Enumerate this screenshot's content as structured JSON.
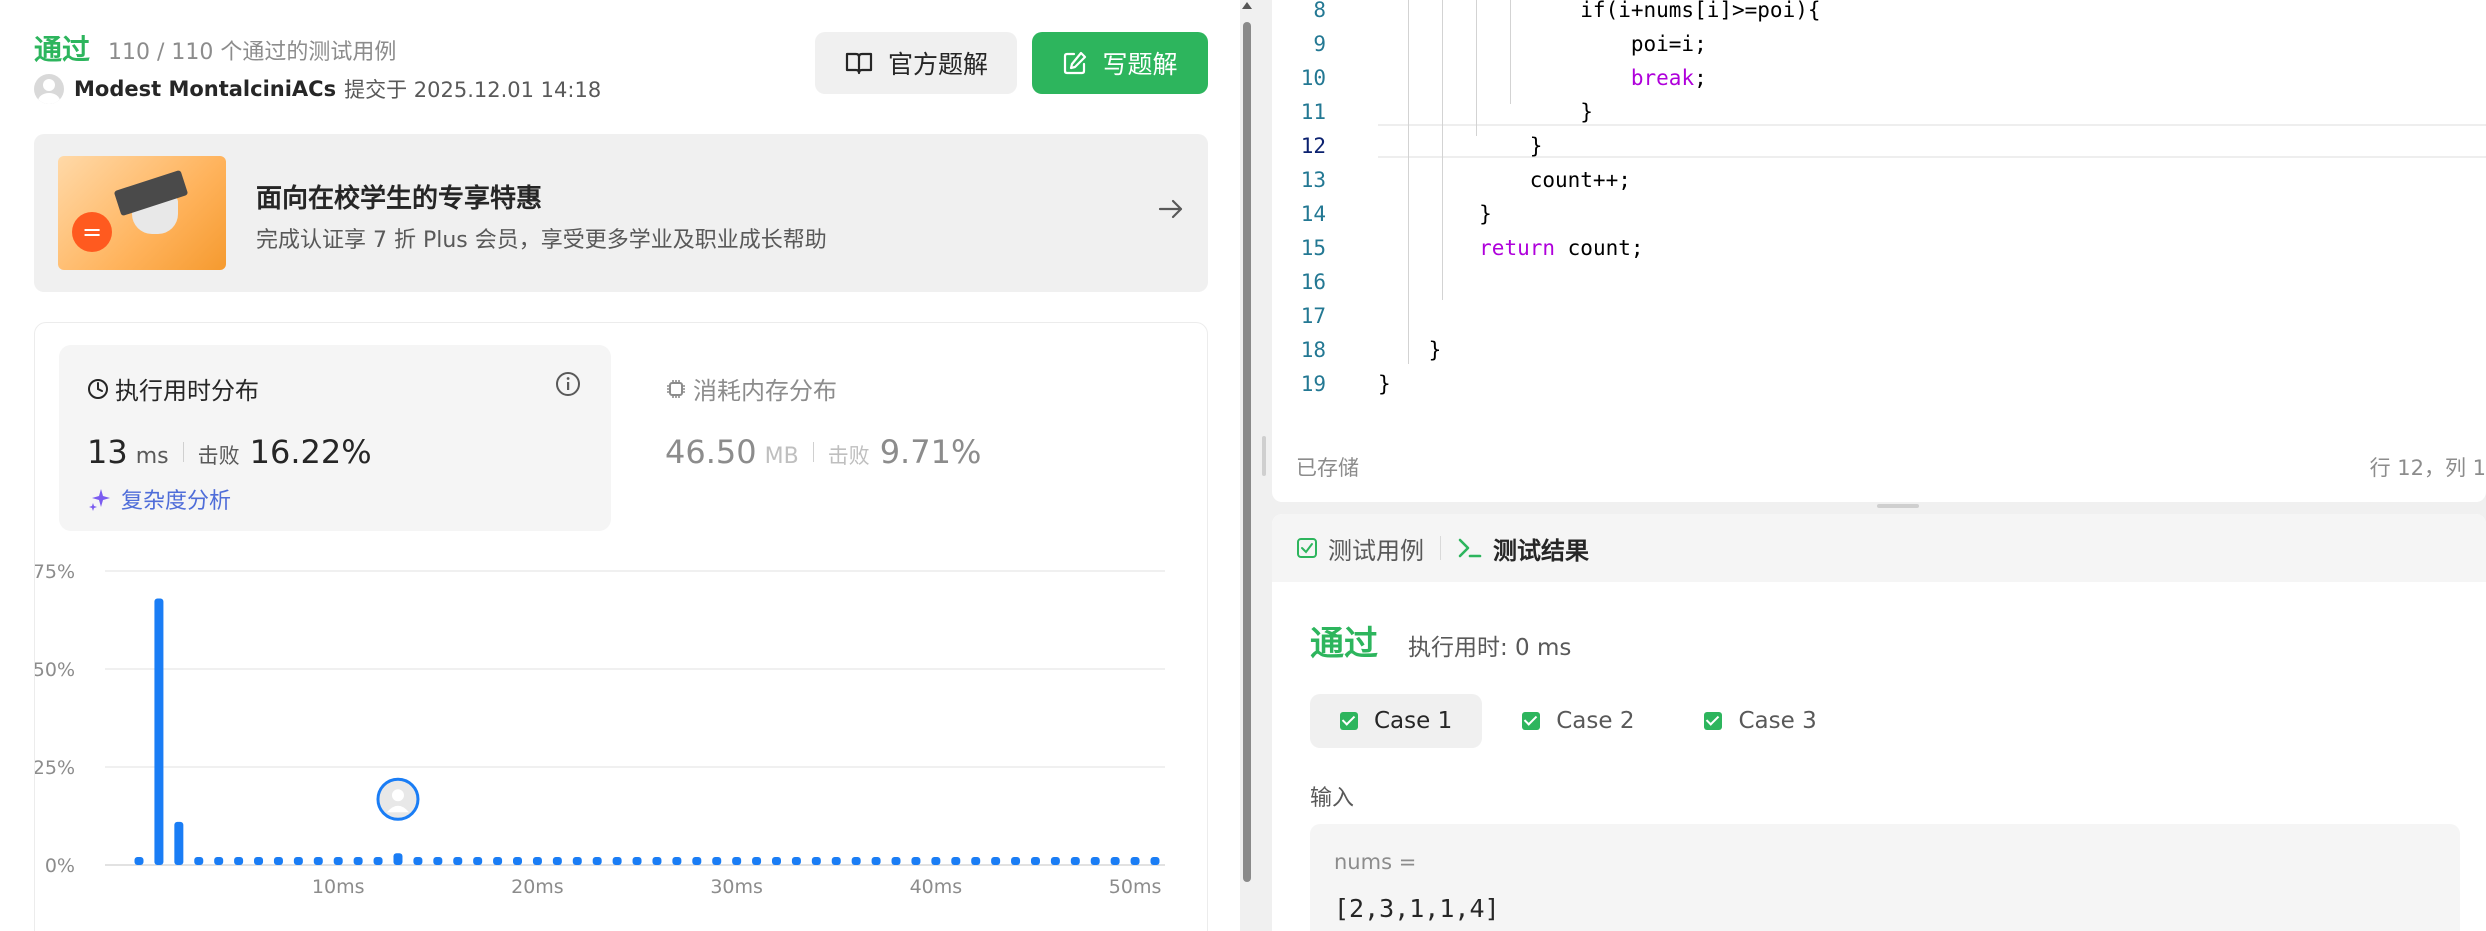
{
  "submission": {
    "status": "通过",
    "cases_summary": "110 / 110 个通过的测试用例",
    "user": "Modest MontalciniACs",
    "submitted_at": "提交于 2025.12.01 14:18"
  },
  "buttons": {
    "official_solution": "官方题解",
    "write_solution": "写题解"
  },
  "promo": {
    "badge": "=",
    "title": "面向在校学生的专享特惠",
    "subtitle": "完成认证享 7 折 Plus 会员，享受更多学业及职业成长帮助"
  },
  "runtime": {
    "title": "执行用时分布",
    "value": "13",
    "unit": "ms",
    "beat_label": "击败",
    "beat_pct": "16.22%",
    "complexity_link": "复杂度分析"
  },
  "memory": {
    "title": "消耗内存分布",
    "value": "46.50",
    "unit": "MB",
    "beat_label": "击败",
    "beat_pct": "9.71%"
  },
  "chart_data": {
    "type": "bar",
    "y_ticks": [
      "75%",
      "50%",
      "25%",
      "0%"
    ],
    "ylim": [
      0,
      75
    ],
    "x_ticks": [
      {
        "label": "10ms",
        "value": 10
      },
      {
        "label": "20ms",
        "value": 20
      },
      {
        "label": "30ms",
        "value": 30
      },
      {
        "label": "40ms",
        "value": 40
      },
      {
        "label": "50ms",
        "value": 50
      }
    ],
    "x": [
      0,
      1,
      2,
      3,
      4,
      5,
      6,
      7,
      8,
      9,
      10,
      11,
      12,
      13,
      14,
      15,
      16,
      17,
      18,
      19,
      20,
      21,
      22,
      23,
      24,
      25,
      26,
      27,
      28,
      29,
      30,
      31,
      32,
      33,
      34,
      35,
      36,
      37,
      38,
      39,
      40,
      41,
      42,
      43,
      44,
      45,
      46,
      47,
      48,
      49,
      50,
      51
    ],
    "values": [
      1.5,
      68,
      11,
      1.5,
      1.5,
      1.5,
      1.5,
      1.5,
      1.5,
      1.5,
      1.5,
      1.5,
      1.5,
      3,
      1.5,
      1.5,
      1.5,
      1.5,
      1.5,
      1.5,
      1.5,
      1.5,
      1.5,
      1.5,
      1.5,
      1.5,
      1.5,
      1.5,
      1.5,
      1.5,
      1.5,
      1.5,
      1.5,
      1.5,
      1.5,
      1.5,
      1.5,
      1.5,
      1.5,
      1.5,
      1.5,
      1.5,
      1.5,
      1.5,
      1.5,
      1.5,
      1.5,
      1.5,
      1.5,
      1.5,
      1.5,
      1.5
    ],
    "highlight_x": 13,
    "bar_color": "#1a7df5",
    "grid": true
  },
  "editor": {
    "lines": [
      {
        "n": "8",
        "text": "                if(i+nums[i]>=poi){"
      },
      {
        "n": "9",
        "text": "                    poi=i;"
      },
      {
        "n": "10",
        "text": "                    break;",
        "kw": true
      },
      {
        "n": "11",
        "text": "                }"
      },
      {
        "n": "12",
        "text": "            }"
      },
      {
        "n": "13",
        "text": "            count++;"
      },
      {
        "n": "14",
        "text": "        }"
      },
      {
        "n": "15",
        "text": "        return count;",
        "kw": true
      },
      {
        "n": "16",
        "text": ""
      },
      {
        "n": "17",
        "text": ""
      },
      {
        "n": "18",
        "text": "    }"
      },
      {
        "n": "19",
        "text": "}"
      }
    ],
    "saved_label": "已存储",
    "cursor_pos": "行 12，列 1"
  },
  "results": {
    "tab_testcase": "测试用例",
    "tab_result": "测试结果",
    "status": "通过",
    "runtime": "执行用时: 0 ms",
    "cases": [
      "Case 1",
      "Case 2",
      "Case 3"
    ],
    "input_label": "输入",
    "input_name": "nums =",
    "input_value": "[2,3,1,1,4]"
  },
  "colors": {
    "accent_green": "#2db55d",
    "link_blue": "#4f6dd9",
    "bar_blue": "#1a7df5"
  }
}
